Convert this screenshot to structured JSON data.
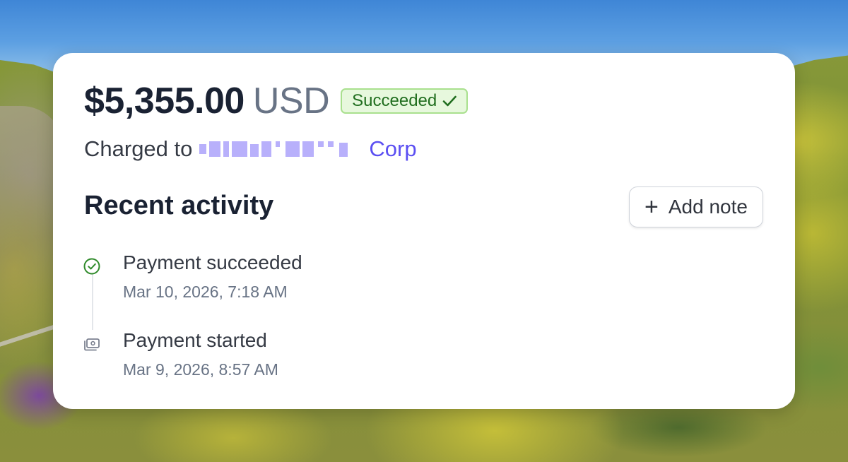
{
  "payment": {
    "amount": "$5,355.00",
    "currency": "USD",
    "status": "Succeeded",
    "charged_prefix": "Charged to",
    "customer_suffix": "Corp"
  },
  "activity": {
    "title": "Recent activity",
    "add_note_label": "Add note",
    "events": [
      {
        "title": "Payment succeeded",
        "time": "Mar 10, 2026, 7:18 AM",
        "icon": "check-circle-icon"
      },
      {
        "title": "Payment started",
        "time": "Mar 9, 2026, 8:57 AM",
        "icon": "payment-method-icon"
      }
    ]
  },
  "colors": {
    "status_bg": "#e7f8dd",
    "status_border": "#a9e08e",
    "status_text": "#216e1f",
    "link": "#5b4ff2",
    "heading": "#1a2233",
    "muted": "#687385"
  }
}
